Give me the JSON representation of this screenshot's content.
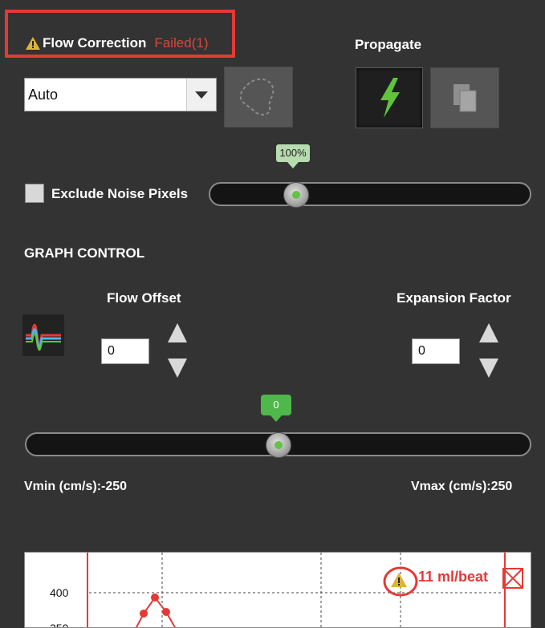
{
  "header": {
    "title": "Flow Correction",
    "status": "Failed(1)",
    "propagate_label": "Propagate"
  },
  "mode_select": {
    "value": "Auto"
  },
  "exclude_noise": {
    "label": "Exclude Noise Pixels",
    "checked": false,
    "slider_value": "100%",
    "slider_level": 0.23
  },
  "graph_control": {
    "heading": "GRAPH CONTROL",
    "flow_offset": {
      "label": "Flow Offset",
      "value": "0"
    },
    "expansion_factor": {
      "label": "Expansion Factor",
      "value": "0"
    },
    "velocity_slider": {
      "value": "0",
      "level": 0.5
    },
    "vmin_label": "Vmin (cm/s):-250",
    "vmax_label": "Vmax (cm/s):250"
  },
  "chart": {
    "warning_text": "11 ml/beat",
    "tick_400": "400",
    "tick_350": "350"
  },
  "colors": {
    "panel": "#333333",
    "highlight": "#e53935",
    "failed": "#d8473b",
    "accent_green": "#64c244",
    "curve": "#e53935"
  },
  "icons": {
    "warning": "warning-triangle-icon",
    "dropdown": "chevron-down-icon",
    "roi": "roi-contour-icon",
    "propagate_all": "lightning-icon",
    "copy": "copy-pages-icon",
    "graph": "flow-curve-icon",
    "close": "close-box-icon"
  }
}
